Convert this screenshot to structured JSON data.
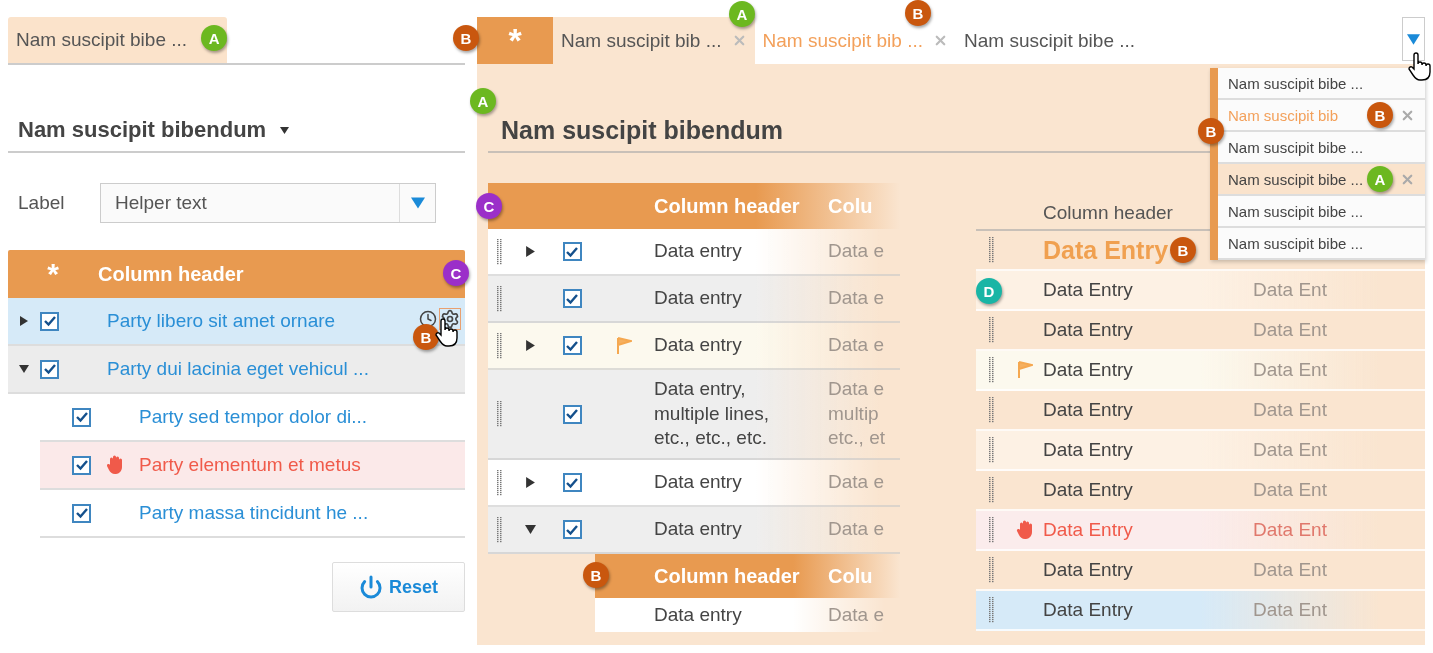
{
  "left": {
    "tab": {
      "label": "Nam suscipit bibe ...",
      "selected": true,
      "badge": {
        "letter": "A",
        "color": "#6cb820"
      }
    },
    "section_title": "Nam suscipit bibendum",
    "field": {
      "label": "Label",
      "value": "Helper text"
    },
    "tree": {
      "columns": [
        "*",
        "Column header"
      ],
      "badge": {
        "letter": "C",
        "color": "#9b2fc9"
      },
      "rows": [
        {
          "text": "Party libero sit amet ornare",
          "checked": true,
          "expanded": false,
          "selected": true,
          "error": false,
          "badge": {
            "letter": "B",
            "color": "#c9570e"
          }
        },
        {
          "text": "Party dui lacinia eget vehicul ...",
          "checked": true,
          "expanded": true,
          "selected": false,
          "error": false,
          "children": [
            {
              "text": "Party sed tempor dolor di...",
              "checked": true,
              "selected": false,
              "error": false
            },
            {
              "text": "Party elementum et metus",
              "checked": true,
              "selected": false,
              "error": true
            },
            {
              "text": "Party massa tincidunt he ...",
              "checked": true,
              "selected": false,
              "error": false
            }
          ]
        }
      ]
    },
    "reset_button": "Reset"
  },
  "right": {
    "tabs": [
      {
        "kind": "star",
        "label": "*",
        "badge": {
          "letter": "B",
          "color": "#c9570e"
        }
      },
      {
        "kind": "text",
        "label": "Nam suscipit bib ...",
        "selected": true,
        "hovered": false,
        "closable": true,
        "badge": {
          "letter": "A",
          "color": "#6cb820"
        }
      },
      {
        "kind": "text",
        "label": "Nam suscipit bib ...",
        "selected": false,
        "hovered": true,
        "closable": true,
        "badge": {
          "letter": "B",
          "color": "#c9570e"
        }
      },
      {
        "kind": "text",
        "label": "Nam suscipit bibe ...",
        "selected": false,
        "hovered": false,
        "closable": false
      }
    ],
    "menu": {
      "badge": {
        "letter": "B",
        "color": "#c9570e"
      },
      "items": [
        {
          "label": "Nam suscipit bibe ...",
          "hovered": false,
          "selected": false,
          "closable": false
        },
        {
          "label": "Nam suscipit bib",
          "hovered": true,
          "selected": false,
          "closable": true,
          "badge": {
            "letter": "B",
            "color": "#c9570e"
          }
        },
        {
          "label": "Nam suscipit bibe ...",
          "hovered": false,
          "selected": false,
          "closable": false
        },
        {
          "label": "Nam suscipit bibe ...",
          "hovered": false,
          "selected": true,
          "closable": true,
          "badge": {
            "letter": "A",
            "color": "#6cb820"
          }
        },
        {
          "label": "Nam suscipit bibe ...",
          "hovered": false,
          "selected": false,
          "closable": false
        },
        {
          "label": "Nam suscipit bibe ...",
          "hovered": false,
          "selected": false,
          "closable": false
        }
      ]
    },
    "title": "Nam suscipit bibendum",
    "title_badge": {
      "letter": "A",
      "color": "#6cb820"
    },
    "grid": {
      "columns": [
        "Column header",
        "Colu"
      ],
      "badge": {
        "letter": "C",
        "color": "#9b2fc9"
      },
      "rows": [
        {
          "kind": "row",
          "expanded": false,
          "checked": true,
          "flagged": false,
          "cells": [
            "Data entry",
            "Data e"
          ]
        },
        {
          "kind": "row",
          "checked": true,
          "flagged": false,
          "cells": [
            "Data entry",
            "Data e"
          ]
        },
        {
          "kind": "row",
          "expanded": false,
          "checked": true,
          "flagged": true,
          "cells": [
            "Data entry",
            "Data e"
          ]
        },
        {
          "kind": "row",
          "checked": true,
          "flagged": false,
          "cells": [
            "Data entry,\nmultiple lines,\netc., etc., etc.",
            "Data e\nmultip\netc., et"
          ]
        },
        {
          "kind": "row",
          "expanded": false,
          "checked": true,
          "flagged": false,
          "cells": [
            "Data entry",
            "Data e"
          ]
        },
        {
          "kind": "row",
          "expanded": true,
          "checked": true,
          "flagged": false,
          "cells": [
            "Data entry",
            "Data e"
          ]
        },
        {
          "kind": "header",
          "cells": [
            "Column header",
            "Colu"
          ],
          "badge": {
            "letter": "B",
            "color": "#c9570e"
          }
        },
        {
          "kind": "child",
          "cells": [
            "Data entry",
            "Data e"
          ]
        }
      ]
    },
    "list": {
      "columns": [
        "Column header"
      ],
      "rows": [
        {
          "kind": "current",
          "cells": [
            "Data Entry"
          ],
          "badge": {
            "letter": "B",
            "color": "#c9570e"
          }
        },
        {
          "kind": "hover",
          "cells": [
            "Data Entry",
            "Data Ent"
          ],
          "badge": {
            "letter": "D",
            "color": "#19b5a5"
          }
        },
        {
          "kind": "normal",
          "cells": [
            "Data Entry",
            "Data Ent"
          ]
        },
        {
          "kind": "flagged",
          "cells": [
            "Data Entry",
            "Data Ent"
          ]
        },
        {
          "kind": "normal",
          "cells": [
            "Data Entry",
            "Data Ent"
          ]
        },
        {
          "kind": "hover",
          "cells": [
            "Data Entry",
            "Data Ent"
          ]
        },
        {
          "kind": "normal",
          "cells": [
            "Data Entry",
            "Data Ent"
          ]
        },
        {
          "kind": "error",
          "cells": [
            "Data Entry",
            "Data Ent"
          ]
        },
        {
          "kind": "normal",
          "cells": [
            "Data Entry",
            "Data Ent"
          ]
        },
        {
          "kind": "selected",
          "cells": [
            "Data Entry",
            "Data Ent"
          ]
        }
      ]
    }
  }
}
